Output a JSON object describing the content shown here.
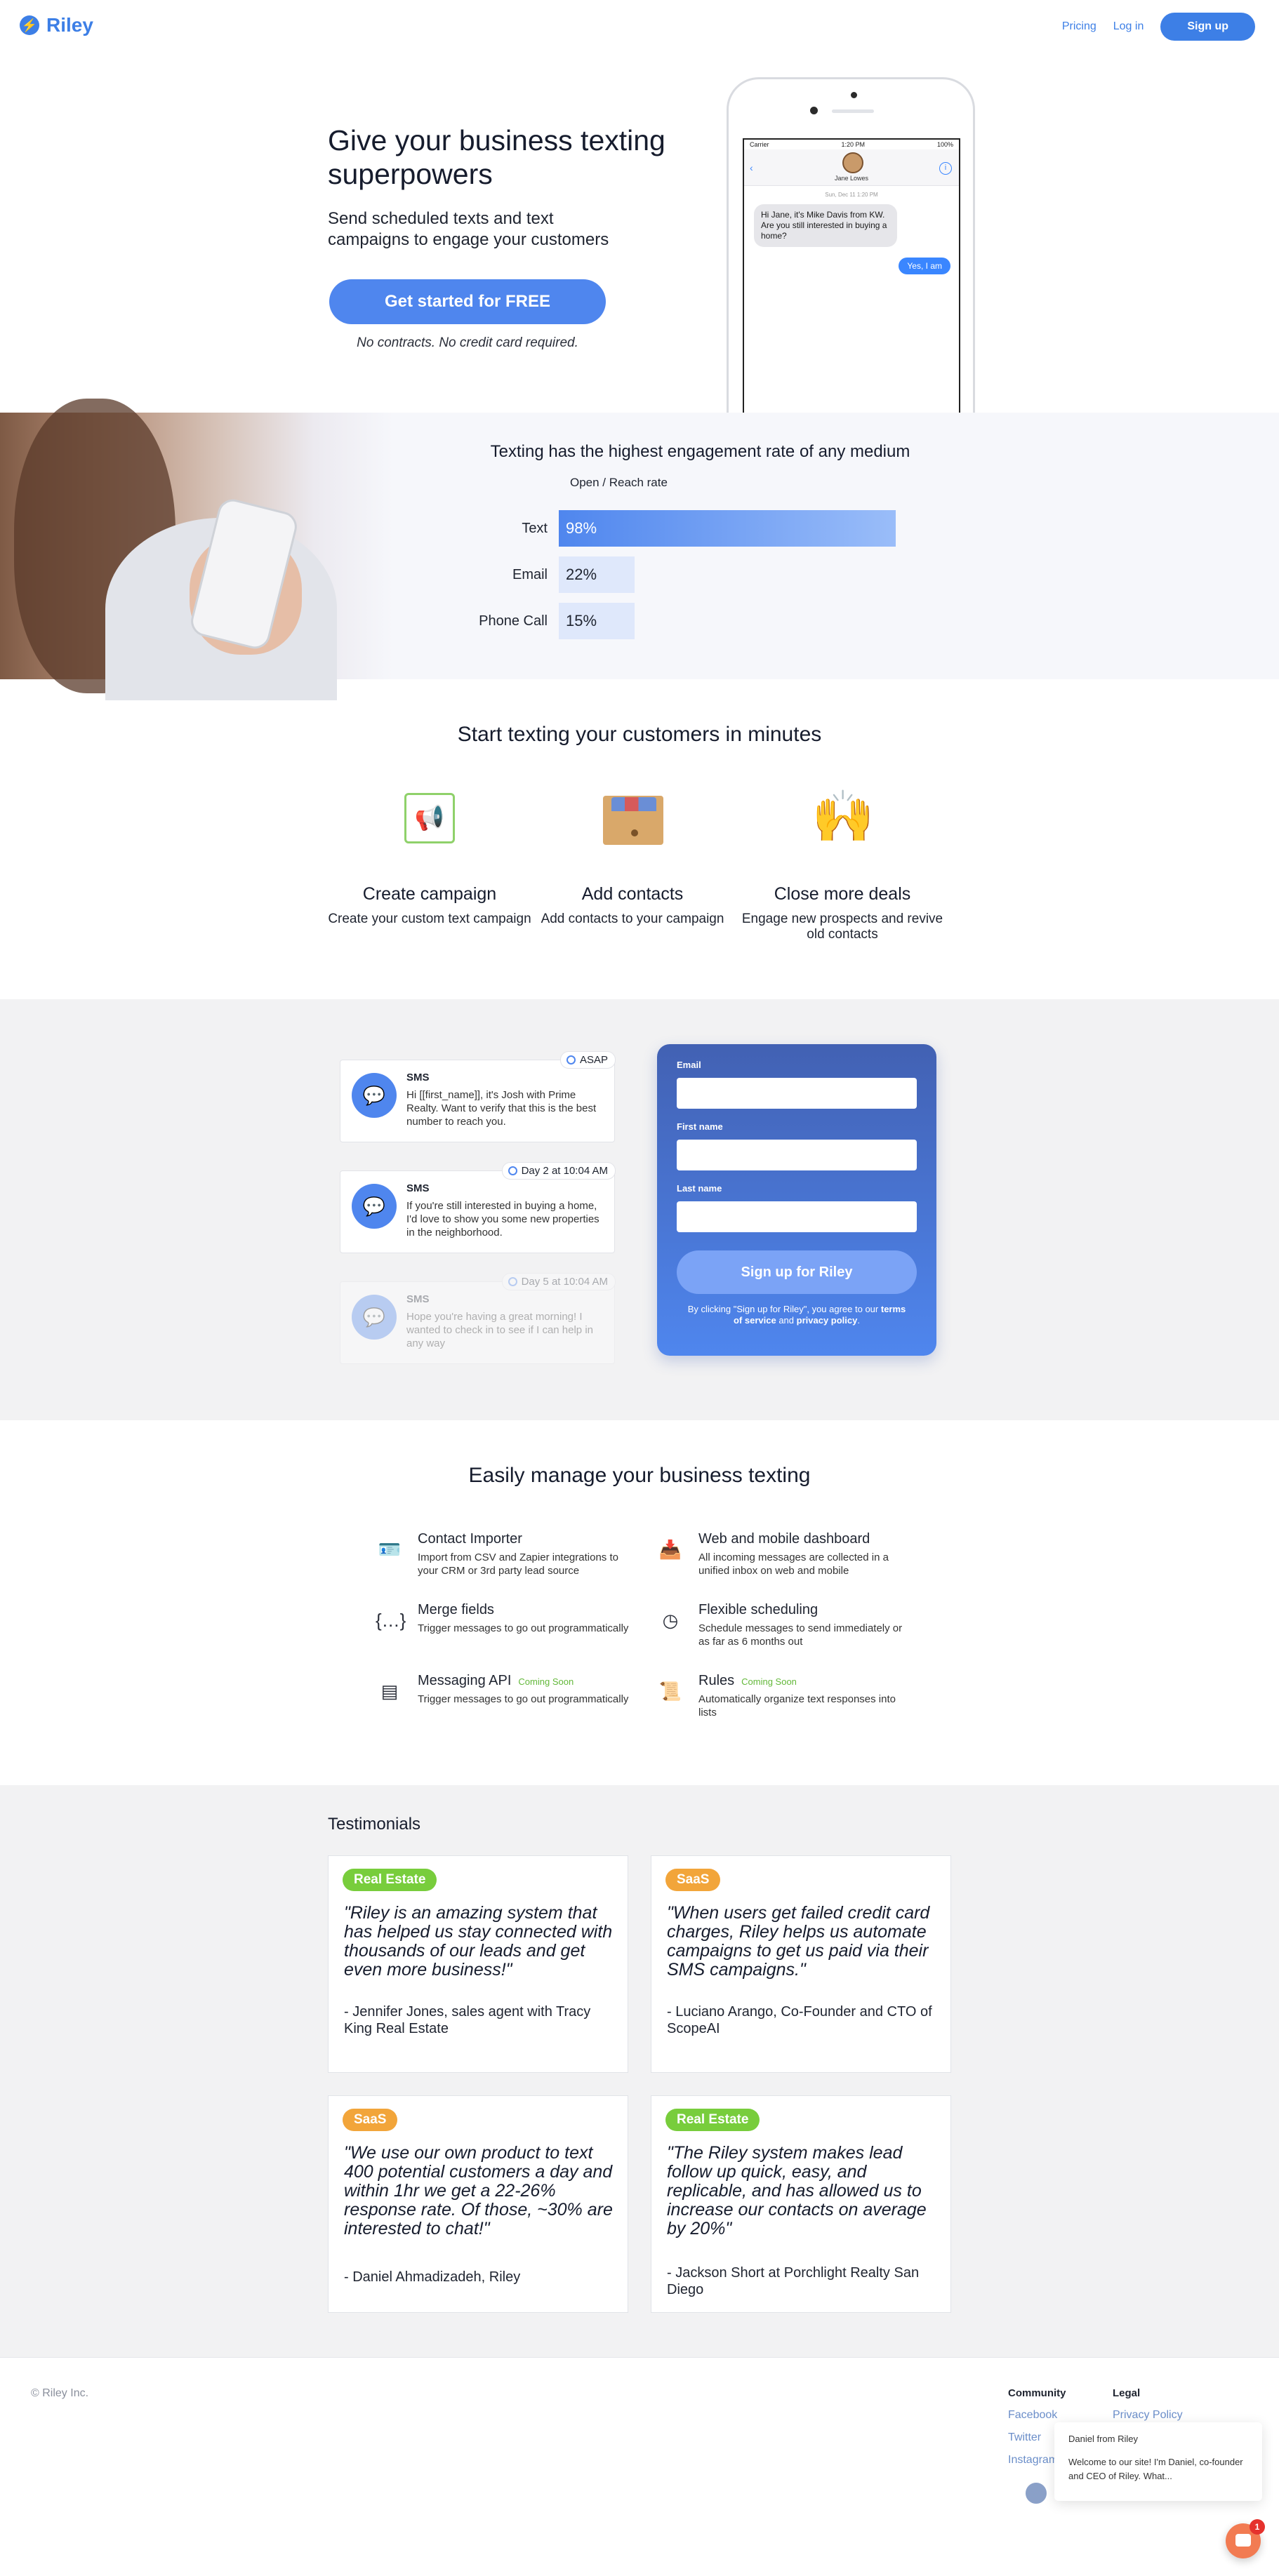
{
  "header": {
    "logo_text": "Riley",
    "logo_icon": "lightning-bolt-icon",
    "nav": {
      "pricing": "Pricing",
      "login": "Log in",
      "signup": "Sign up"
    },
    "accent_color": "#3d7fe6"
  },
  "hero": {
    "title": "Give your business texting superpowers",
    "subtitle": "Send scheduled texts and text campaigns to engage your customers",
    "cta": "Get started for FREE",
    "note": "No contracts. No credit card required.",
    "phone": {
      "carrier": "Carrier",
      "time": "1:20 PM",
      "battery": "100%",
      "back": "‹",
      "contact": "Jane Lowes",
      "date": "Sun, Dec 11 1:20 PM",
      "incoming": "Hi Jane, it's Mike Davis from KW. Are you still interested in buying a home?",
      "outgoing": "Yes, I am"
    }
  },
  "stats": {
    "title": "Texting has the highest engagement rate of any medium",
    "subtitle": "Open / Reach rate",
    "bars": [
      {
        "label": "Text",
        "value": 98,
        "display": "98%"
      },
      {
        "label": "Email",
        "value": 22,
        "display": "22%"
      },
      {
        "label": "Phone Call",
        "value": 15,
        "display": "15%"
      }
    ]
  },
  "steps": {
    "title": "Start texting your customers in minutes",
    "items": [
      {
        "name": "Create campaign",
        "desc": "Create your custom text campaign",
        "icon": "megaphone-icon"
      },
      {
        "name": "Add contacts",
        "desc": "Add contacts to your campaign",
        "icon": "file-box-icon"
      },
      {
        "name": "Close more deals",
        "desc": "Engage new prospects and revive old contacts",
        "icon": "raised-hands-icon"
      }
    ]
  },
  "sequence": [
    {
      "when": "ASAP",
      "type": "SMS",
      "text": "Hi [[first_name]], it's Josh with Prime Realty. Want to verify that this is the best number to reach you."
    },
    {
      "when": "Day 2 at 10:04 AM",
      "type": "SMS",
      "text": "If you're still interested in buying a home, I'd love to show you some new properties in the neighborhood."
    },
    {
      "when": "Day 5 at 10:04 AM",
      "type": "SMS",
      "text": "Hope you're having a great morning! I wanted to check in to see if I can help in any way"
    }
  ],
  "signup_form": {
    "email_label": "Email",
    "first_name_label": "First name",
    "last_name_label": "Last name",
    "button": "Sign up for Riley",
    "note_prefix": "By clicking \"Sign up for Riley\", you agree to our ",
    "terms": "terms of service",
    "and": " and ",
    "privacy": "privacy policy",
    "end": "."
  },
  "features": {
    "title": "Easily manage your business texting",
    "coming_soon": "Coming Soon",
    "items": [
      {
        "name": "Contact Importer",
        "desc": "Import from CSV and Zapier integrations to your CRM or 3rd party lead source",
        "icon": "contact-card-icon"
      },
      {
        "name": "Web and mobile dashboard",
        "desc": "All incoming messages are collected in a unified inbox on web and mobile",
        "icon": "inbox-icon"
      },
      {
        "name": "Merge fields",
        "desc": "Trigger messages to go out programmatically",
        "icon": "curly-braces-icon"
      },
      {
        "name": "Flexible scheduling",
        "desc": "Schedule messages to send immediately or as far as 6 months out",
        "icon": "clock-icon"
      },
      {
        "name": "Messaging API",
        "desc": "Trigger messages to go out programmatically",
        "icon": "terminal-icon"
      },
      {
        "name": "Rules",
        "desc": "Automatically organize text responses into lists",
        "icon": "scroll-icon"
      }
    ]
  },
  "testimonials": {
    "title": "Testimonials",
    "items": [
      {
        "tag": "Real Estate",
        "quote": "\"Riley is an amazing system that has helped us stay connected with thousands of our leads and get even more business!\"",
        "author": "- Jennifer Jones, sales agent with Tracy King Real Estate"
      },
      {
        "tag": "SaaS",
        "quote": "\"When users get failed credit card charges, Riley helps us automate campaigns to get us paid via their SMS campaigns.\"",
        "author": "- Luciano Arango, Co-Founder and CTO of ScopeAI"
      },
      {
        "tag": "SaaS",
        "quote": "\"We use our own product to text 400 potential customers a day and within 1hr we get a 22-26% response rate. Of those, ~30% are interested to chat!\"",
        "author": "- Daniel Ahmadizadeh, Riley"
      },
      {
        "tag": "Real Estate",
        "quote": "\"The Riley system makes lead follow up quick, easy, and replicable, and has allowed us to increase our contacts on average by 20%\"",
        "author": "- Jackson Short at Porchlight Realty San Diego"
      }
    ]
  },
  "footer": {
    "copyright": "© Riley Inc.",
    "community": {
      "title": "Community",
      "links": [
        "Facebook",
        "Twitter",
        "Instagram"
      ]
    },
    "legal": {
      "title": "Legal",
      "links": [
        "Privacy Policy"
      ]
    }
  },
  "chat_widget": {
    "from": "Daniel from Riley",
    "message": "Welcome to our site! I'm Daniel, co-founder and CEO of Riley. What...",
    "badge_count": "1"
  }
}
